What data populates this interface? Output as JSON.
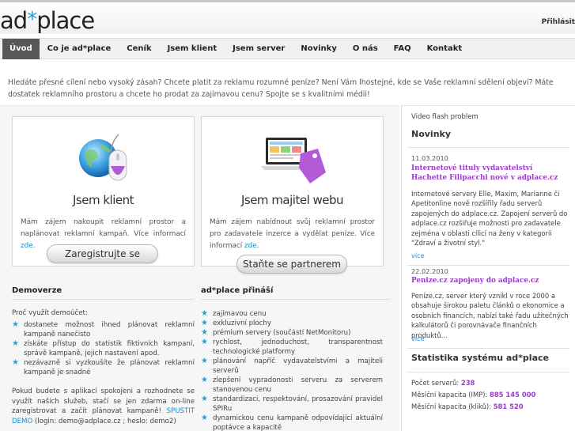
{
  "header": {
    "logo_prefix": "ad",
    "logo_star": "*",
    "logo_suffix": "place",
    "login": "Přihlásit"
  },
  "nav": {
    "items": [
      "Úvod",
      "Co je ad*place",
      "Ceník",
      "Jsem klient",
      "Jsem server",
      "Novinky",
      "O nás",
      "FAQ",
      "Kontakt"
    ],
    "active_index": 0
  },
  "intro": "Hledáte přesné cílení nebo vysoký zásah? Chcete platit za reklamu rozumné peníze? Není Vám lhostejné, kde se Vaše reklamní sdělení objeví? Máte dostatek reklamního prostoru a chcete ho prodat za zajímavou cenu? Spojte se s kvalitními médii!",
  "cards": {
    "client": {
      "title": "Jsem klient",
      "text": "Mám zájem nakoupit reklamní prostor a naplánovat reklamní kampaň. Více informací ",
      "link": "zde",
      "text_end": ".",
      "button": "Zaregistrujte se",
      "icon": "globe-mouse-icon"
    },
    "owner": {
      "title": "Jsem majitel webu",
      "text": "Mám zájem nabídnout svůj reklamní prostor pro zadavatele inzerce a vydělat peníze. Více informací ",
      "link": "zde",
      "text_end": ".",
      "button": "Staňte se partnerem",
      "icon": "laptop-tag-icon"
    }
  },
  "demo": {
    "title": "Demoverze",
    "intro": "Proč využít demoúčet:",
    "bullets": [
      "dostanete možnost ihned plánovat reklamní kampaně nanečisto",
      "získáte přístup do statistik fiktivních kampaní, správě kampaně, jejich nastavení apod.",
      "nezávazně si vyzkoušíte že plánovat reklamní kampaně je snadné"
    ],
    "bottom_text": "Pokud budete s aplikací spokojeni a rozhodnete se využít našich služeb, stačí se jen zdarma on-line zaregistrovat a začít plánovat kampaně! ",
    "bottom_link": "SPUSTIT DEMO",
    "bottom_end": " (login: demo@adplace.cz ; heslo: demo2)"
  },
  "benefits": {
    "title": "ad*place přináší",
    "bullets": [
      "zajímavou cenu",
      "exkluzivní plochy",
      "prémium servery (součástí NetMonitoru)",
      "rychlost, jednoduchost, transparentnost technologické platformy",
      "plánování napříč vydavatelstvími a majiteli serverů",
      "zlepšení vypradonosti serveru za serverem stanovenou cenu",
      "standardizaci, respektování, prosazování pravidel SPIRu",
      "dynamickou cenu kampaně odpovídající aktuální poptávce a kapacitě"
    ]
  },
  "sidebar": {
    "video": "Video flash problem",
    "news_title": "Novinky",
    "news": [
      {
        "date": "11.03.2010",
        "title": "Internetové tituly vydavatelství Hachette Filipacchi nové v adplace.cz",
        "body": "Internetové servery Elle, Maxim, Marianne či Apetitonline nově rozšířily řadu serverů zapojených do adplace.cz. Zapojení serverů do adplace.cz rozšiřuje možnosti pro zadavatele zejména v oblasti cílicí na ženy v kategorii \"Zdraví a životní styl.\"",
        "more": "více"
      },
      {
        "date": "22.02.2010",
        "title": "Penize.cz zapojeny do adplace.cz",
        "body": "Peníze.cz, server který vznikl v roce 2000 a obsahuje širokou paletu článků o ekonomice a osobních financích, nabízí také řadu užitečných kalkulátorů či porovnávače finančních produktů...",
        "more": "více"
      }
    ],
    "stats_title": "Statistika systému ad*place",
    "stats": [
      {
        "label": "Počet serverů: ",
        "value": "238"
      },
      {
        "label": "Měsíční kapacita (IMP): ",
        "value": "885 145 000"
      },
      {
        "label": "Měsíční kapacita (kliků): ",
        "value": "581 520"
      }
    ]
  },
  "colors": {
    "accent_blue": "#2a9fd6",
    "news_purple": "#9b3cc8",
    "nav_active": "#575757"
  }
}
